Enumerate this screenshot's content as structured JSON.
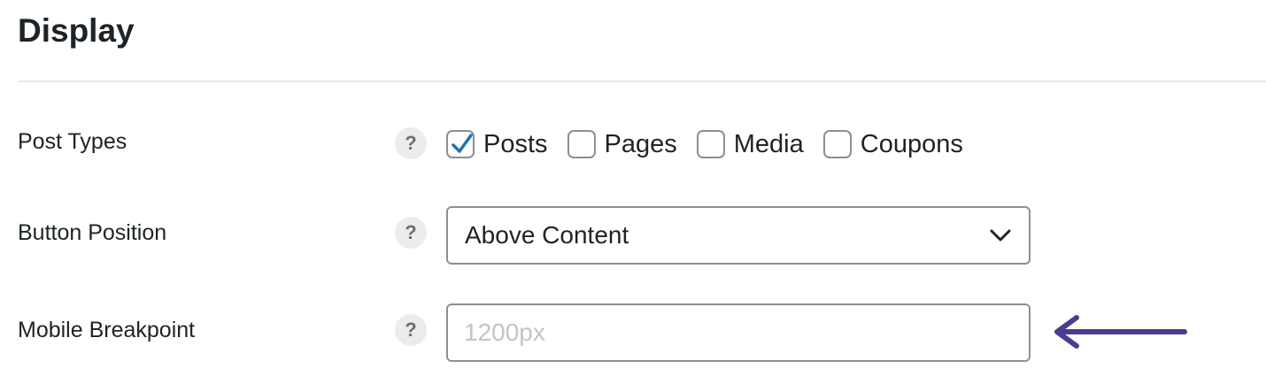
{
  "section": {
    "title": "Display"
  },
  "rows": {
    "post_types": {
      "label": "Post Types",
      "help_icon": "?",
      "options": [
        {
          "label": "Posts",
          "checked": true
        },
        {
          "label": "Pages",
          "checked": false
        },
        {
          "label": "Media",
          "checked": false
        },
        {
          "label": "Coupons",
          "checked": false
        }
      ]
    },
    "button_position": {
      "label": "Button Position",
      "help_icon": "?",
      "selected": "Above Content"
    },
    "mobile_breakpoint": {
      "label": "Mobile Breakpoint",
      "help_icon": "?",
      "value": "",
      "placeholder": "1200px"
    }
  },
  "colors": {
    "checkmark": "#2271b1",
    "annotation_arrow": "#4b3c8f",
    "border": "#8c8f94"
  },
  "icons": {
    "help": "question-mark-icon",
    "select": "chevron-down-icon",
    "annotation": "arrow-left-icon"
  }
}
